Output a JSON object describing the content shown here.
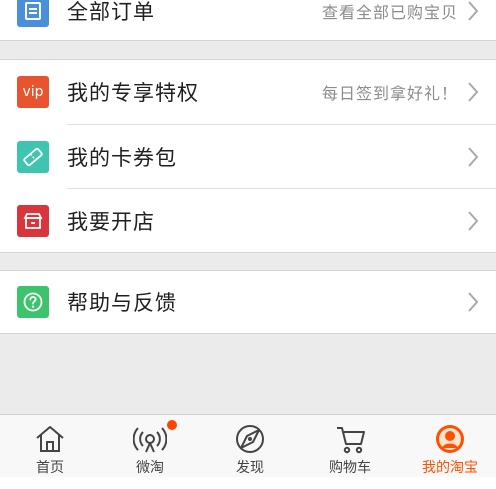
{
  "colors": {
    "accent": "#ff5000",
    "orders_icon_bg": "#4a90d9",
    "vip_icon_bg": "#e8542e",
    "coupon_icon_bg": "#3fc4b0",
    "shop_icon_bg": "#d8363c",
    "help_icon_bg": "#3ec36d"
  },
  "orders": {
    "label": "全部订单",
    "hint": "查看全部已购宝贝",
    "icon": "clipboard-icon"
  },
  "menu": [
    {
      "label": "我的专享特权",
      "hint": "每日签到拿好礼！",
      "icon": "vip-icon",
      "icon_text": "vip"
    },
    {
      "label": "我的卡券包",
      "hint": "",
      "icon": "ticket-icon"
    },
    {
      "label": "我要开店",
      "hint": "",
      "icon": "shop-icon"
    }
  ],
  "help": {
    "label": "帮助与反馈",
    "hint": "",
    "icon": "question-icon"
  },
  "tabbar": [
    {
      "label": "首页",
      "icon": "home-icon"
    },
    {
      "label": "微淘",
      "icon": "broadcast-icon",
      "has_dot": true
    },
    {
      "label": "发现",
      "icon": "compass-icon"
    },
    {
      "label": "购物车",
      "icon": "cart-icon"
    },
    {
      "label": "我的淘宝",
      "icon": "profile-icon",
      "active": true
    }
  ]
}
